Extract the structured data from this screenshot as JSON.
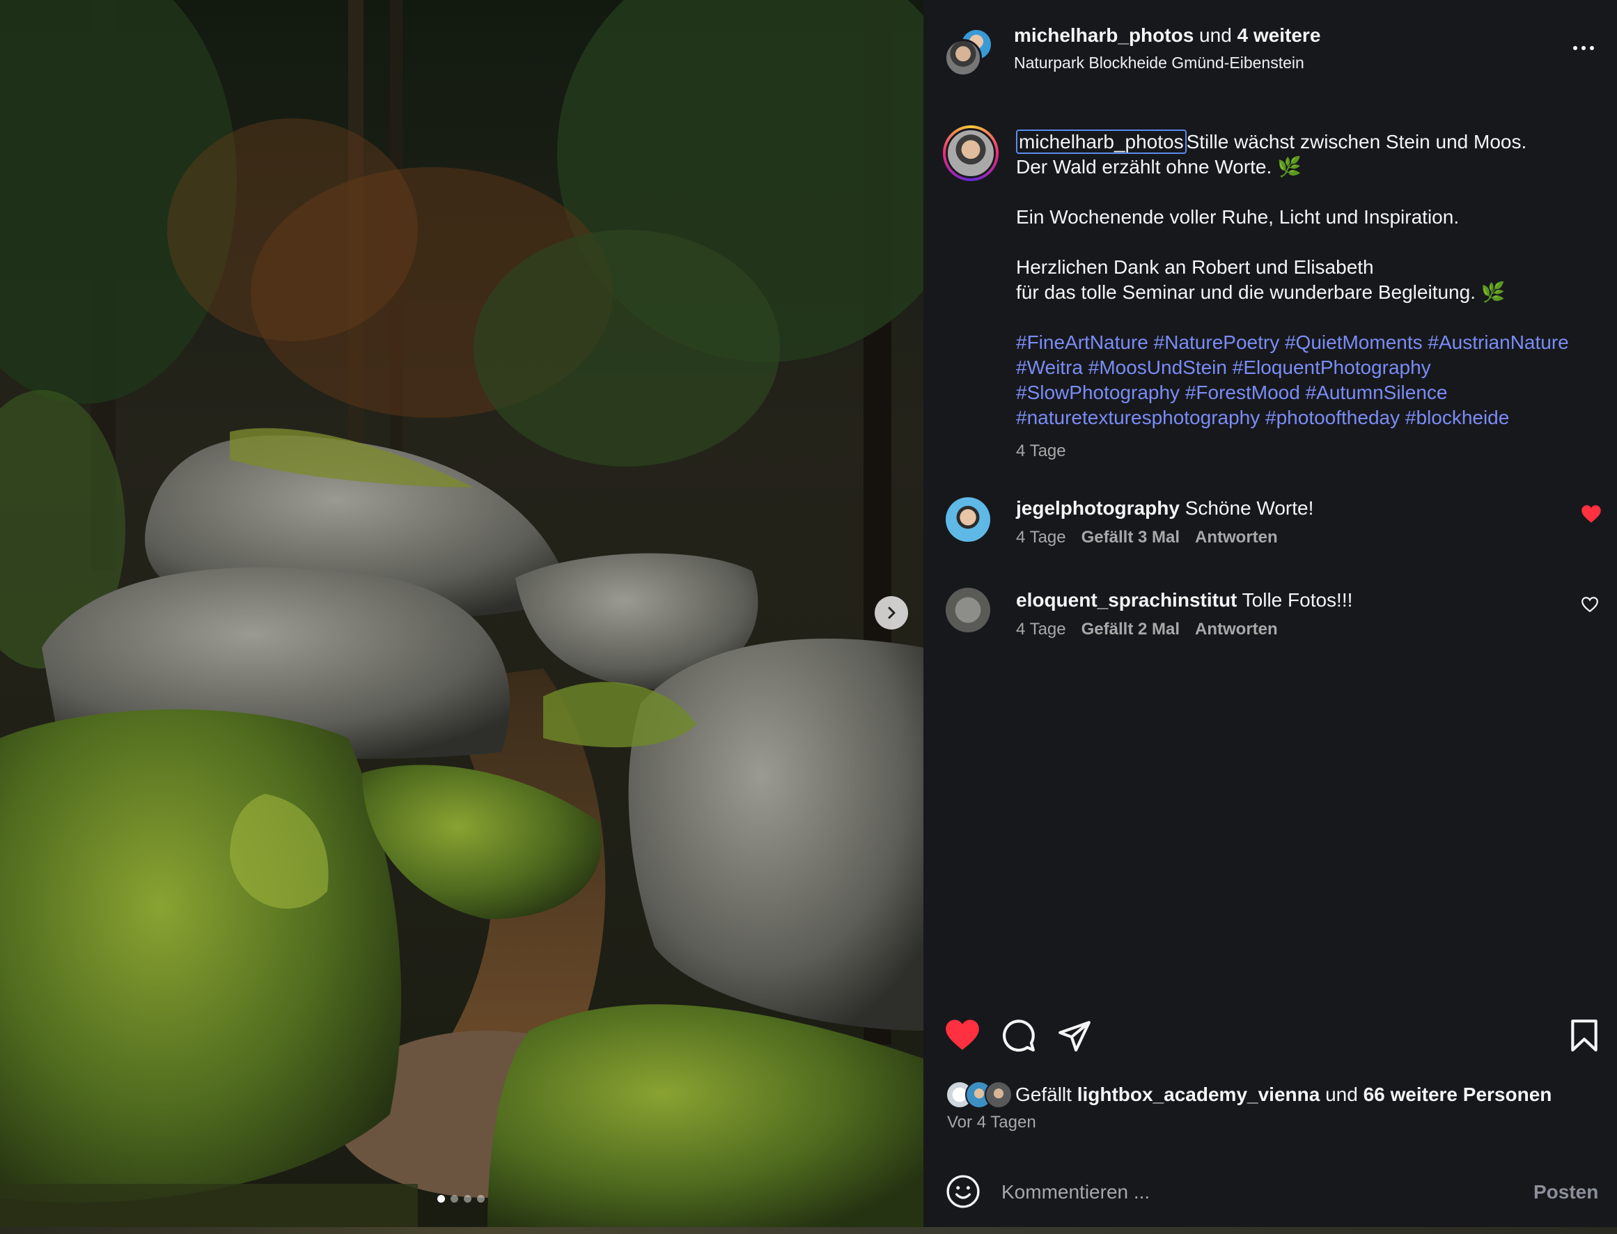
{
  "post": {
    "header": {
      "username": "michelharb_photos",
      "and_word": "und",
      "others": "4 weitere",
      "location": "Naturpark Blockheide Gmünd-Eibenstein"
    },
    "caption": {
      "username": "michelharb_photos",
      "line1": "Stille wächst zwischen Stein und Moos.",
      "line2": "Der Wald erzählt ohne Worte. 🌿",
      "line3": "Ein Wochenende voller Ruhe, Licht und Inspiration.",
      "line4": "Herzlichen Dank an Robert und Elisabeth",
      "line5": "für das tolle Seminar und die wunderbare Begleitung. 🌿",
      "hashtags": [
        [
          "#FineArtNature",
          "#NaturePoetry",
          "#QuietMoments",
          "#AustrianNature"
        ],
        [
          "#Weitra",
          "#MoosUndStein",
          "#EloquentPhotography"
        ],
        [
          "#SlowPhotography",
          "#ForestMood",
          "#AutumnSilence"
        ],
        [
          "#naturetexturesphotography",
          "#photooftheday",
          "#blockheide"
        ]
      ],
      "time": "4 Tage"
    },
    "comments": [
      {
        "username": "jegelphotography",
        "text": "Schöne Worte!",
        "time": "4 Tage",
        "likes": "Gefällt 3 Mal",
        "reply": "Antworten",
        "liked": true
      },
      {
        "username": "eloquent_sprachinstitut",
        "text": "Tolle Fotos!!!",
        "time": "4 Tage",
        "likes": "Gefällt 2 Mal",
        "reply": "Antworten",
        "liked": false
      }
    ],
    "likes": {
      "prefix": "Gefällt",
      "user": "lightbox_academy_vienna",
      "and_word": "und",
      "others": "66 weitere Personen"
    },
    "posted": "Vor 4 Tagen",
    "compose": {
      "placeholder": "Kommentieren ...",
      "post_label": "Posten"
    },
    "carousel": {
      "count": 4,
      "active": 0
    }
  },
  "colors": {
    "panel_bg": "#17181c",
    "hashtag": "#7b8cf5",
    "heart_red": "#ff3040",
    "muted": "#a8a8a8"
  },
  "icons": [
    "chevron-right-icon",
    "more-icon",
    "heart-icon",
    "comment-icon",
    "share-icon",
    "bookmark-icon",
    "emoji-icon"
  ]
}
